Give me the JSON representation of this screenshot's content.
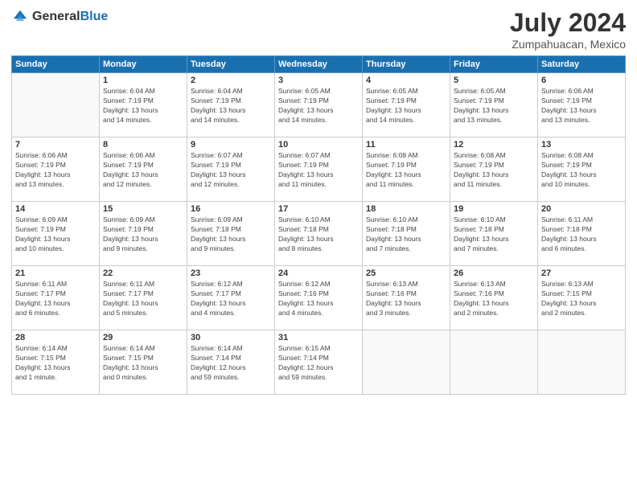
{
  "logo": {
    "general": "General",
    "blue": "Blue"
  },
  "title": "July 2024",
  "location": "Zumpahuacan, Mexico",
  "days_header": [
    "Sunday",
    "Monday",
    "Tuesday",
    "Wednesday",
    "Thursday",
    "Friday",
    "Saturday"
  ],
  "weeks": [
    [
      {
        "day": "",
        "info": ""
      },
      {
        "day": "1",
        "info": "Sunrise: 6:04 AM\nSunset: 7:19 PM\nDaylight: 13 hours\nand 14 minutes."
      },
      {
        "day": "2",
        "info": "Sunrise: 6:04 AM\nSunset: 7:19 PM\nDaylight: 13 hours\nand 14 minutes."
      },
      {
        "day": "3",
        "info": "Sunrise: 6:05 AM\nSunset: 7:19 PM\nDaylight: 13 hours\nand 14 minutes."
      },
      {
        "day": "4",
        "info": "Sunrise: 6:05 AM\nSunset: 7:19 PM\nDaylight: 13 hours\nand 14 minutes."
      },
      {
        "day": "5",
        "info": "Sunrise: 6:05 AM\nSunset: 7:19 PM\nDaylight: 13 hours\nand 13 minutes."
      },
      {
        "day": "6",
        "info": "Sunrise: 6:06 AM\nSunset: 7:19 PM\nDaylight: 13 hours\nand 13 minutes."
      }
    ],
    [
      {
        "day": "7",
        "info": "Sunrise: 6:06 AM\nSunset: 7:19 PM\nDaylight: 13 hours\nand 13 minutes."
      },
      {
        "day": "8",
        "info": "Sunrise: 6:06 AM\nSunset: 7:19 PM\nDaylight: 13 hours\nand 12 minutes."
      },
      {
        "day": "9",
        "info": "Sunrise: 6:07 AM\nSunset: 7:19 PM\nDaylight: 13 hours\nand 12 minutes."
      },
      {
        "day": "10",
        "info": "Sunrise: 6:07 AM\nSunset: 7:19 PM\nDaylight: 13 hours\nand 11 minutes."
      },
      {
        "day": "11",
        "info": "Sunrise: 6:08 AM\nSunset: 7:19 PM\nDaylight: 13 hours\nand 11 minutes."
      },
      {
        "day": "12",
        "info": "Sunrise: 6:08 AM\nSunset: 7:19 PM\nDaylight: 13 hours\nand 11 minutes."
      },
      {
        "day": "13",
        "info": "Sunrise: 6:08 AM\nSunset: 7:19 PM\nDaylight: 13 hours\nand 10 minutes."
      }
    ],
    [
      {
        "day": "14",
        "info": "Sunrise: 6:09 AM\nSunset: 7:19 PM\nDaylight: 13 hours\nand 10 minutes."
      },
      {
        "day": "15",
        "info": "Sunrise: 6:09 AM\nSunset: 7:19 PM\nDaylight: 13 hours\nand 9 minutes."
      },
      {
        "day": "16",
        "info": "Sunrise: 6:09 AM\nSunset: 7:18 PM\nDaylight: 13 hours\nand 9 minutes."
      },
      {
        "day": "17",
        "info": "Sunrise: 6:10 AM\nSunset: 7:18 PM\nDaylight: 13 hours\nand 8 minutes."
      },
      {
        "day": "18",
        "info": "Sunrise: 6:10 AM\nSunset: 7:18 PM\nDaylight: 13 hours\nand 7 minutes."
      },
      {
        "day": "19",
        "info": "Sunrise: 6:10 AM\nSunset: 7:18 PM\nDaylight: 13 hours\nand 7 minutes."
      },
      {
        "day": "20",
        "info": "Sunrise: 6:11 AM\nSunset: 7:18 PM\nDaylight: 13 hours\nand 6 minutes."
      }
    ],
    [
      {
        "day": "21",
        "info": "Sunrise: 6:11 AM\nSunset: 7:17 PM\nDaylight: 13 hours\nand 6 minutes."
      },
      {
        "day": "22",
        "info": "Sunrise: 6:11 AM\nSunset: 7:17 PM\nDaylight: 13 hours\nand 5 minutes."
      },
      {
        "day": "23",
        "info": "Sunrise: 6:12 AM\nSunset: 7:17 PM\nDaylight: 13 hours\nand 4 minutes."
      },
      {
        "day": "24",
        "info": "Sunrise: 6:12 AM\nSunset: 7:16 PM\nDaylight: 13 hours\nand 4 minutes."
      },
      {
        "day": "25",
        "info": "Sunrise: 6:13 AM\nSunset: 7:16 PM\nDaylight: 13 hours\nand 3 minutes."
      },
      {
        "day": "26",
        "info": "Sunrise: 6:13 AM\nSunset: 7:16 PM\nDaylight: 13 hours\nand 2 minutes."
      },
      {
        "day": "27",
        "info": "Sunrise: 6:13 AM\nSunset: 7:15 PM\nDaylight: 13 hours\nand 2 minutes."
      }
    ],
    [
      {
        "day": "28",
        "info": "Sunrise: 6:14 AM\nSunset: 7:15 PM\nDaylight: 13 hours\nand 1 minute."
      },
      {
        "day": "29",
        "info": "Sunrise: 6:14 AM\nSunset: 7:15 PM\nDaylight: 13 hours\nand 0 minutes."
      },
      {
        "day": "30",
        "info": "Sunrise: 6:14 AM\nSunset: 7:14 PM\nDaylight: 12 hours\nand 59 minutes."
      },
      {
        "day": "31",
        "info": "Sunrise: 6:15 AM\nSunset: 7:14 PM\nDaylight: 12 hours\nand 59 minutes."
      },
      {
        "day": "",
        "info": ""
      },
      {
        "day": "",
        "info": ""
      },
      {
        "day": "",
        "info": ""
      }
    ]
  ]
}
